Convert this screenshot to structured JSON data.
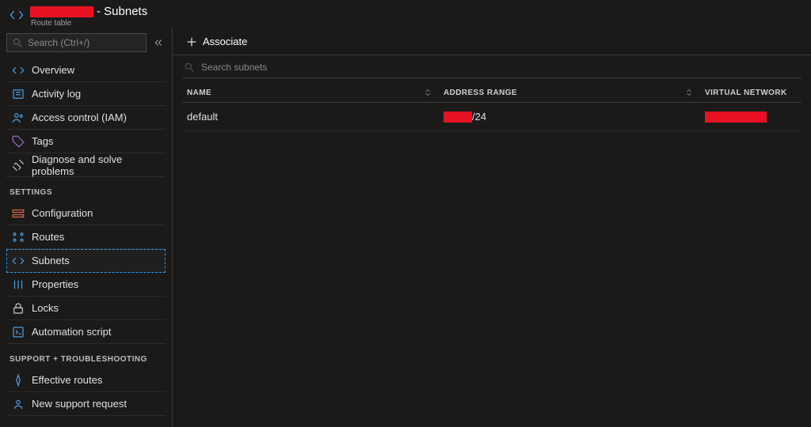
{
  "header": {
    "resource_name_redacted": true,
    "page_title_suffix": " - Subnets",
    "resource_type": "Route table"
  },
  "sidebar": {
    "search_placeholder": "Search (Ctrl+/)",
    "top_items": [
      {
        "icon": "overview",
        "label": "Overview"
      },
      {
        "icon": "activity",
        "label": "Activity log"
      },
      {
        "icon": "iam",
        "label": "Access control (IAM)"
      },
      {
        "icon": "tags",
        "label": "Tags"
      },
      {
        "icon": "diagnose",
        "label": "Diagnose and solve problems"
      }
    ],
    "section_settings": "SETTINGS",
    "settings_items": [
      {
        "icon": "config",
        "label": "Configuration"
      },
      {
        "icon": "routes",
        "label": "Routes"
      },
      {
        "icon": "subnets",
        "label": "Subnets",
        "selected": true
      },
      {
        "icon": "props",
        "label": "Properties"
      },
      {
        "icon": "locks",
        "label": "Locks"
      },
      {
        "icon": "script",
        "label": "Automation script"
      }
    ],
    "section_support": "SUPPORT + TROUBLESHOOTING",
    "support_items": [
      {
        "icon": "effroutes",
        "label": "Effective routes"
      },
      {
        "icon": "support",
        "label": "New support request"
      }
    ]
  },
  "toolbar": {
    "associate_label": "Associate"
  },
  "main": {
    "search_placeholder": "Search subnets",
    "columns": {
      "name": "NAME",
      "addr": "ADDRESS RANGE",
      "vnet": "VIRTUAL NETWORK"
    },
    "rows": [
      {
        "name": "default",
        "address_range_prefix_redacted": true,
        "address_range_suffix": "/24",
        "vnet_redacted": true
      }
    ]
  }
}
